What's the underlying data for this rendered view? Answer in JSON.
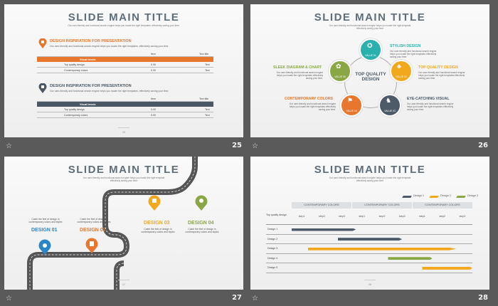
{
  "slides": [
    {
      "number": "25",
      "title": "SLIDE MAIN TITLE",
      "subtitle": "Our user-friendly and functional search engine helps you locate the right templates, effectively saving your time.",
      "page": "25"
    },
    {
      "number": "26",
      "title": "SLIDE MAIN TITLE",
      "subtitle": "Our user-friendly and functional search engine helps you locate the right template\neffectively saving your time",
      "page": "26"
    },
    {
      "number": "27",
      "title": "SLIDE MAIN TITLE",
      "subtitle": "Our user-friendly and functional search engine helps you locate the right template\neffectively saving your time",
      "page": "27"
    },
    {
      "number": "28",
      "title": "SLIDE MAIN TITLE",
      "subtitle": "Our user-friendly and functional search engine helps you locate the right template\neffectively saving your time",
      "page": "28"
    }
  ],
  "s25": {
    "sections": [
      {
        "title": "DESIGN INSPIRATION  FOR PRESENTATION",
        "desc": "Our user-friendly and functional search engine helps you locate the right templates, effectively saving your time.",
        "color": "#e8762c",
        "header": [
          "Item",
          "Text title"
        ],
        "bar": "Visual trends",
        "rows": [
          [
            "Top quality design",
            "0.00",
            "Text"
          ],
          [
            "Contemporary colors",
            "0.00",
            "Text"
          ]
        ]
      },
      {
        "title": "DESIGN INSPIRATION  FOR PRESENTATION",
        "desc": "Our user-friendly and functional search engine helps you locate the right templates, effectively saving your time.",
        "color": "#4a5866",
        "header": [
          "Item",
          "Text title"
        ],
        "bar": "Visual trends",
        "rows": [
          [
            "Top quality design",
            "0.00",
            "Text"
          ],
          [
            "Contemporary colors",
            "0.00",
            "Text"
          ]
        ]
      }
    ]
  },
  "s26": {
    "center": "TOP QUALITY DESIGN",
    "items": [
      {
        "label": "STYLISH DESIGN",
        "desc": "Our user-friendly and functional search engine helps you locate the right templates effectively saving your time.",
        "value": "VALUE 01",
        "color": "#2ab0ad"
      },
      {
        "label": "TOP QUALITY DESIGN",
        "desc": "Our user-friendly and functional search engine helps you locate the right templates effectively saving your time.",
        "value": "VALUE 02",
        "color": "#f2a81d"
      },
      {
        "label": "EYE-CATCHING VISUAL",
        "desc": "Our user-friendly and functional search engine helps you locate the right templates effectively saving your time.",
        "value": "VALUE 03",
        "color": "#4d5b68"
      },
      {
        "label": "CONTEMPORARY COLORS",
        "desc": "Our user-friendly and functional search engine helps you locate the right templates effectively saving your time.",
        "value": "VALUE 04",
        "color": "#e8762c"
      },
      {
        "label": "SLEEK DIAGRAM & CHART",
        "desc": "Our user-friendly and functional search engine helps you locate the right templates effectively saving your time.",
        "value": "VALUE 05",
        "color": "#8aa745"
      }
    ]
  },
  "s27": {
    "designs": [
      {
        "label": "DESIGN 01",
        "desc": "Catch the feel of design in contemporary colors and styles",
        "color": "#2a86c6"
      },
      {
        "label": "DESIGN 02",
        "desc": "Catch the feel of design in contemporary colors and styles",
        "color": "#e8762c"
      },
      {
        "label": "DESIGN 03",
        "desc": "Catch the feel of design in contemporary colors and styles",
        "color": "#f2a81d"
      },
      {
        "label": "DESIGN 04",
        "desc": "Catch the feel of design in contemporary colors and styles",
        "color": "#8aa745"
      }
    ]
  },
  "s28": {
    "legend": [
      {
        "label": "Design 1",
        "color": "#4d5b68"
      },
      {
        "label": "Design 2",
        "color": "#f2a81d"
      },
      {
        "label": "Design 3",
        "color": "#8aa745"
      }
    ],
    "groups": [
      "CONTEMPORARY COLORS",
      "CONTEMPORARY COLORS",
      "CONTEMPORARY COLORS"
    ],
    "row_header": "Top quality design",
    "steps": [
      "step1",
      "step2",
      "step3",
      "step1",
      "step2",
      "step3",
      "step1",
      "step2",
      "step3"
    ],
    "rows": [
      {
        "label": "Design 1",
        "start": 0,
        "end": 3.2,
        "color": "#4d5b68"
      },
      {
        "label": "Design 2",
        "start": 2.3,
        "end": 5.5,
        "color": "#4d5b68"
      },
      {
        "label": "Design 3",
        "start": 0.8,
        "end": 8.2,
        "color": "#f2a81d"
      },
      {
        "label": "Design 4",
        "start": 4.8,
        "end": 7.0,
        "color": "#8aa745"
      },
      {
        "label": "Design 5",
        "start": 6.5,
        "end": 9.0,
        "color": "#f2a81d"
      }
    ]
  }
}
